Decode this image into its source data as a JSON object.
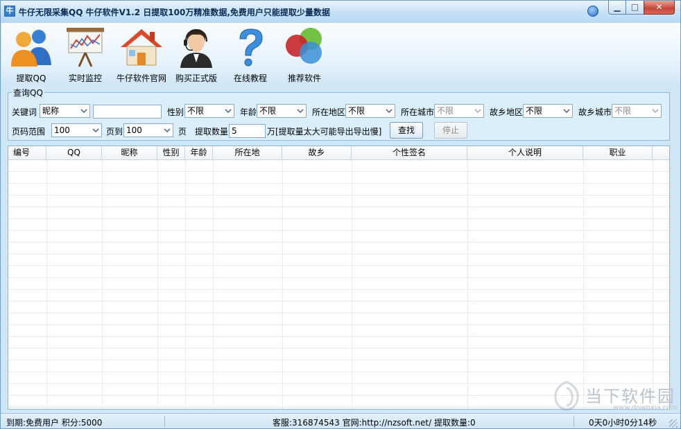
{
  "window": {
    "app_icon_char": "牛",
    "title": "牛仔无限采集QQ  牛仔软件V1.2 日提取100万精准数据,免费用户只能提取少量数据",
    "min_label": "▁",
    "max_label": "□",
    "close_label": "✕"
  },
  "toolbar": {
    "items": [
      {
        "label": "提取QQ",
        "icon": "users-icon"
      },
      {
        "label": "实时监控",
        "icon": "chart-board-icon"
      },
      {
        "label": "牛仔软件官网",
        "icon": "home-icon"
      },
      {
        "label": "购买正式版",
        "icon": "headset-agent-icon"
      },
      {
        "label": "在线教程",
        "icon": "question-icon"
      },
      {
        "label": "推荐软件",
        "icon": "color-circles-icon"
      }
    ]
  },
  "query": {
    "group_label": "查询QQ",
    "keyword_label": "关键词",
    "keyword_type": "昵称",
    "keyword_value": "",
    "gender_label": "性别",
    "gender_value": "不限",
    "age_label": "年龄",
    "age_value": "不限",
    "region_label": "所在地区",
    "region_value": "不限",
    "city_label": "所在城市",
    "city_value": "不限",
    "hometown_region_label": "故乡地区",
    "hometown_region_value": "不限",
    "hometown_city_label": "故乡城市",
    "hometown_city_value": "不限",
    "page_range_label": "页码范围",
    "page_from": "100",
    "page_to_label": "页到",
    "page_to": "100",
    "page_unit": "页",
    "amount_label": "提取数量",
    "amount_value": "5",
    "amount_note": "万[提取量太大可能导出导出慢]",
    "search_button": "查找",
    "stop_button": "停止"
  },
  "table": {
    "columns": [
      "编号",
      "QQ",
      "昵称",
      "性别",
      "年龄",
      "所在地",
      "故乡",
      "个性签名",
      "个人说明",
      "职业"
    ],
    "rows": []
  },
  "status": {
    "left": "到期:免费用户 积分:5000",
    "center": "客服:316874543 官网:http://nzsoft.net/ 提取数量:0",
    "right": "0天0小时0分14秒"
  },
  "watermark": {
    "text": "当下软件园",
    "url": "www.downxia.com"
  },
  "colors": {
    "accent": "#2f7fd0",
    "window_bg": "#cfe6f7",
    "close_red": "#c7453a"
  }
}
